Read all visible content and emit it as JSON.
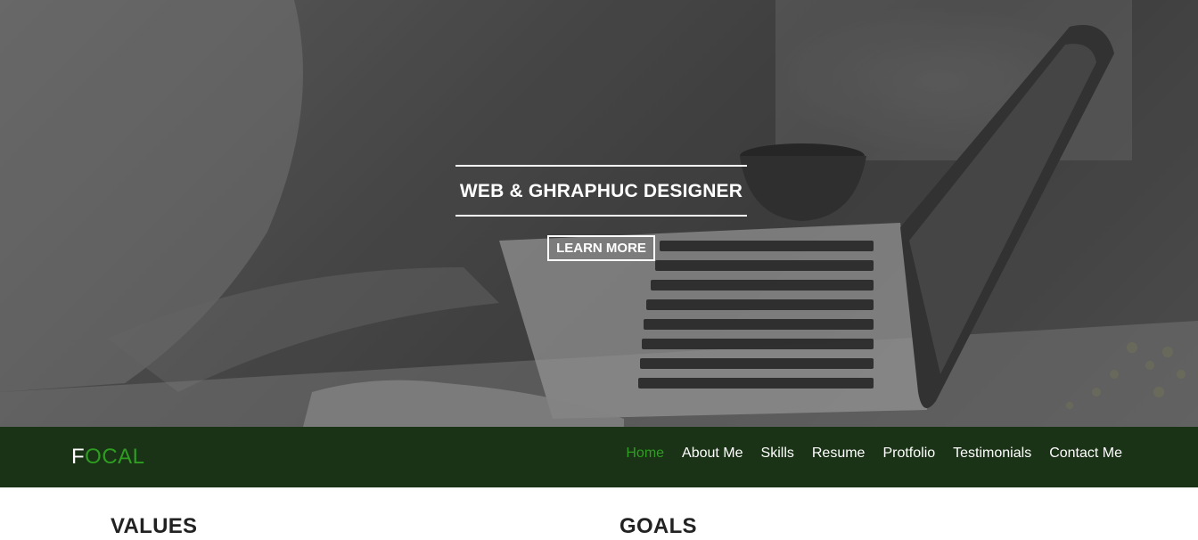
{
  "hero": {
    "title": "WEB & GHRAPHUC DESIGNER",
    "cta_label": "LEARN MORE"
  },
  "brand": {
    "first": "F",
    "rest": "OCAL"
  },
  "nav": {
    "items": [
      "Home",
      "About Me",
      "Skills",
      "Resume",
      "Protfolio",
      "Testimonials",
      "Contact Me"
    ],
    "active_color": "#2e9d22"
  },
  "sections": {
    "values_title": "VALUES",
    "goals_title": "GOALS"
  },
  "colors": {
    "navbar_bg": "#1a3215",
    "accent": "#2e9d22"
  }
}
